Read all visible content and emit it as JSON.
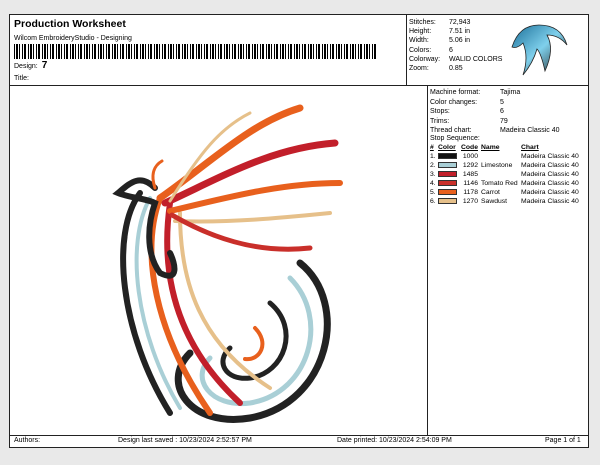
{
  "header": {
    "title": "Production Worksheet",
    "software": "Wilcom EmbroideryStudio - Designing",
    "design_label": "Design:",
    "design_value": "7",
    "title_label": "Title:"
  },
  "specs": [
    {
      "label": "Stitches:",
      "value": "72,943"
    },
    {
      "label": "Height:",
      "value": "7.51 in"
    },
    {
      "label": "Width:",
      "value": "5.06 in"
    },
    {
      "label": "Colors:",
      "value": "6"
    },
    {
      "label": "Colorway:",
      "value": "WALID COLORS"
    },
    {
      "label": "Zoom:",
      "value": "0.85"
    }
  ],
  "machine": [
    {
      "label": "Machine format:",
      "value": "Tajima"
    },
    {
      "label": "Color changes:",
      "value": "5"
    },
    {
      "label": "Stops:",
      "value": "6"
    },
    {
      "label": "Trims:",
      "value": "79"
    },
    {
      "label": "Thread chart:",
      "value": "Madeira Classic 40"
    }
  ],
  "stop_sequence": {
    "title": "Stop Sequence:",
    "headers": {
      "num": "#",
      "color": "Color",
      "code": "Code",
      "name": "Name",
      "chart": "Chart"
    },
    "rows": [
      {
        "num": "1.",
        "color": "#111111",
        "code": "1000",
        "name": "",
        "chart": "Madeira Classic 40"
      },
      {
        "num": "2.",
        "color": "#a9cfd6",
        "code": "1292",
        "name": "Limestone",
        "chart": "Madeira Classic 40"
      },
      {
        "num": "3.",
        "color": "#c21f2a",
        "code": "1485",
        "name": "",
        "chart": "Madeira Classic 40"
      },
      {
        "num": "4.",
        "color": "#c92f2a",
        "code": "1146",
        "name": "Tomato Red",
        "chart": "Madeira Classic 40"
      },
      {
        "num": "5.",
        "color": "#e8601d",
        "code": "1178",
        "name": "Carrot",
        "chart": "Madeira Classic 40"
      },
      {
        "num": "6.",
        "color": "#e6c08a",
        "code": "1270",
        "name": "Sawdust",
        "chart": "Madeira Classic 40"
      }
    ]
  },
  "footer": {
    "authors": "Authors:",
    "last_saved": "Design last saved : 10/23/2024 2:52:57 PM",
    "printed": "Date printed: 10/23/2024 2:54:09 PM",
    "page": "Page 1 of 1"
  }
}
